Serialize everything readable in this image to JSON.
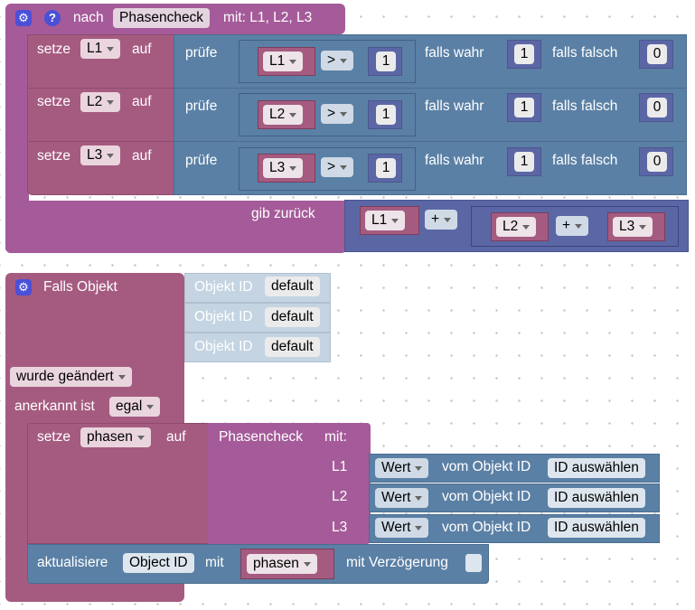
{
  "func_block": {
    "prefix": "nach",
    "name": "Phasencheck",
    "params": "mit: L1, L2, L3",
    "rows": [
      {
        "setze": "setze",
        "var": "L1",
        "auf": "auf",
        "pruefe": "prüfe",
        "cmp_var": "L1",
        "op": ">",
        "cmp_val": "1",
        "if_true_label": "falls wahr",
        "if_true": "1",
        "if_false_label": "falls falsch",
        "if_false": "0"
      },
      {
        "setze": "setze",
        "var": "L2",
        "auf": "auf",
        "pruefe": "prüfe",
        "cmp_var": "L2",
        "op": ">",
        "cmp_val": "1",
        "if_true_label": "falls wahr",
        "if_true": "1",
        "if_false_label": "falls falsch",
        "if_false": "0"
      },
      {
        "setze": "setze",
        "var": "L3",
        "auf": "auf",
        "pruefe": "prüfe",
        "cmp_var": "L3",
        "op": ">",
        "cmp_val": "1",
        "if_true_label": "falls wahr",
        "if_true": "1",
        "if_false_label": "falls falsch",
        "if_false": "0"
      }
    ],
    "return_label": "gib zurück",
    "return_a": "L1",
    "op1": "+",
    "return_b": "L2",
    "op2": "+",
    "return_c": "L3"
  },
  "trigger_block": {
    "title": "Falls Objekt",
    "object_label": "Objekt ID",
    "object_values": [
      "default",
      "default",
      "default"
    ],
    "changed": "wurde geändert",
    "ack_label": "anerkannt ist",
    "ack_value": "egal",
    "setze": "setze",
    "var": "phasen",
    "auf": "auf",
    "call_name": "Phasencheck",
    "call_mit": "mit:",
    "args": [
      {
        "name": "L1",
        "prop": "Wert",
        "from": "vom Objekt ID",
        "id": "ID auswählen"
      },
      {
        "name": "L2",
        "prop": "Wert",
        "from": "vom Objekt ID",
        "id": "ID auswählen"
      },
      {
        "name": "L3",
        "prop": "Wert",
        "from": "vom Objekt ID",
        "id": "ID auswählen"
      }
    ],
    "update_label": "aktualisiere",
    "update_target": "Object ID",
    "update_mit": "mit",
    "update_var": "phasen",
    "delay_label": "mit Verzögerung"
  },
  "colors": {
    "procedure": "#a55b99",
    "variable": "#a55b80",
    "logic": "#5b80a5",
    "math": "#5b67a5",
    "trigger_inputs": "#c4d4e2",
    "gear": "#4a50d8"
  },
  "icons": {
    "gear": "gear-icon",
    "help": "help-icon"
  }
}
